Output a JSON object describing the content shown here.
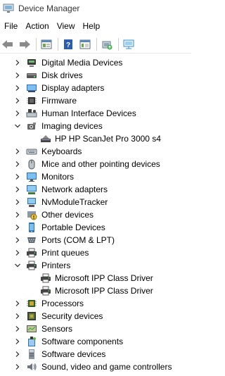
{
  "window": {
    "title": "Device Manager"
  },
  "menu": [
    "File",
    "Action",
    "View",
    "Help"
  ],
  "toolbar": {
    "buttons": [
      "back-icon",
      "forward-icon",
      "properties-icon",
      "help-icon",
      "resource-view-icon",
      "update-driver-icon",
      "scan-hardware-icon"
    ]
  },
  "tree": {
    "categories": [
      {
        "label": "Digital Media Devices",
        "icon": "media-icon",
        "expanded": false
      },
      {
        "label": "Disk drives",
        "icon": "disk-icon",
        "expanded": false
      },
      {
        "label": "Display adapters",
        "icon": "display-icon",
        "expanded": false
      },
      {
        "label": "Firmware",
        "icon": "chip-icon",
        "expanded": false
      },
      {
        "label": "Human Interface Devices",
        "icon": "hid-icon",
        "expanded": false
      },
      {
        "label": "Imaging devices",
        "icon": "camera-icon",
        "expanded": true,
        "children": [
          "HP HP ScanJet Pro 3000 s4"
        ]
      },
      {
        "label": "Keyboards",
        "icon": "keyboard-icon",
        "expanded": false
      },
      {
        "label": "Mice and other pointing devices",
        "icon": "mouse-icon",
        "expanded": false
      },
      {
        "label": "Monitors",
        "icon": "monitor-icon",
        "expanded": false
      },
      {
        "label": "Network adapters",
        "icon": "network-icon",
        "expanded": false
      },
      {
        "label": "NvModuleTracker",
        "icon": "generic-device-icon",
        "expanded": false
      },
      {
        "label": "Other devices",
        "icon": "unknown-device-icon",
        "expanded": false
      },
      {
        "label": "Portable Devices",
        "icon": "portable-icon",
        "expanded": false
      },
      {
        "label": "Ports (COM & LPT)",
        "icon": "port-icon",
        "expanded": false
      },
      {
        "label": "Print queues",
        "icon": "printer-icon",
        "expanded": false
      },
      {
        "label": "Printers",
        "icon": "printer-icon",
        "expanded": true,
        "children": [
          "Microsoft IPP Class Driver",
          "Microsoft IPP Class Driver"
        ]
      },
      {
        "label": "Processors",
        "icon": "processor-icon",
        "expanded": false
      },
      {
        "label": "Security devices",
        "icon": "security-icon",
        "expanded": false
      },
      {
        "label": "Sensors",
        "icon": "sensor-icon",
        "expanded": false
      },
      {
        "label": "Software components",
        "icon": "software-component-icon",
        "expanded": false
      },
      {
        "label": "Software devices",
        "icon": "software-device-icon",
        "expanded": false
      },
      {
        "label": "Sound, video and game controllers",
        "icon": "sound-icon",
        "expanded": false
      }
    ]
  }
}
